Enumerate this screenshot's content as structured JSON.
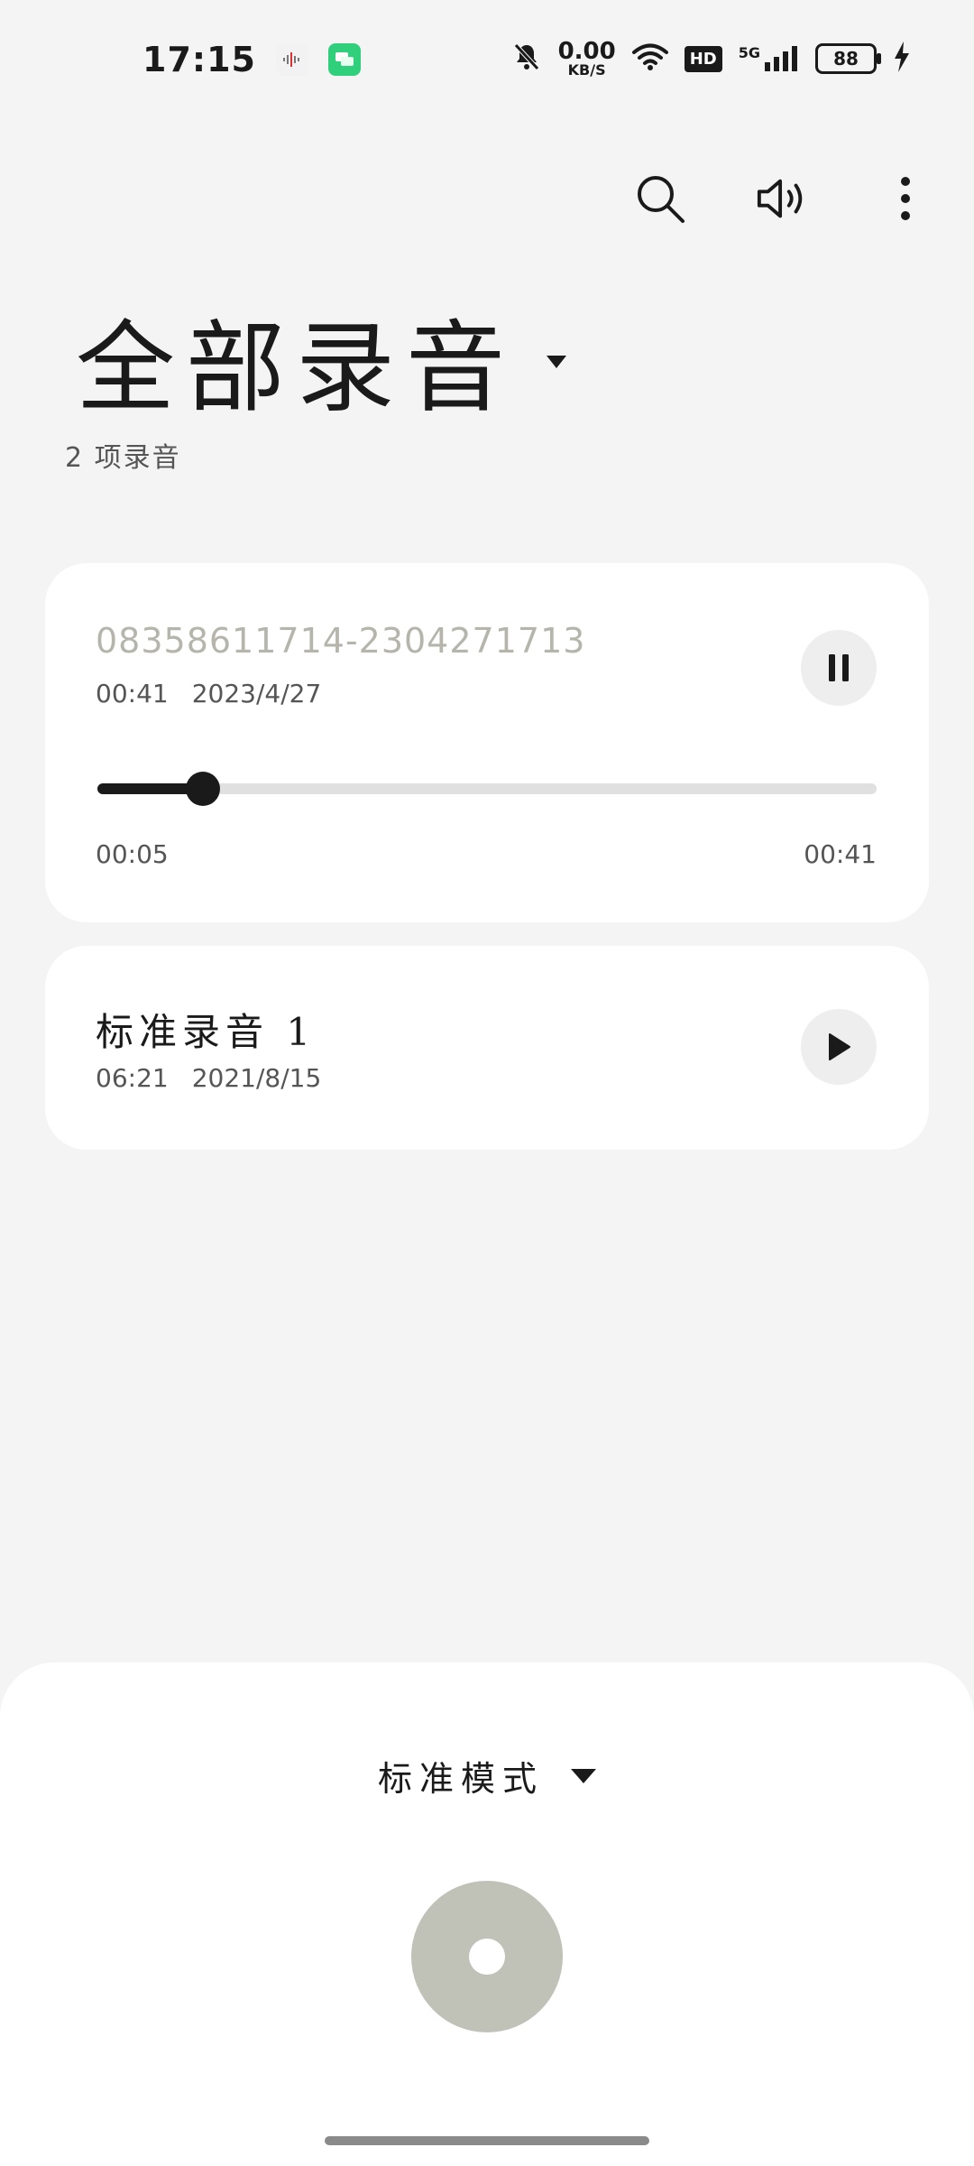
{
  "status_bar": {
    "time": "17:15",
    "net_speed_value": "0.00",
    "net_speed_unit": "KB/S",
    "hd_label": "HD",
    "signal_label": "5G",
    "battery_level": "88"
  },
  "toolbar": {
    "search_icon": "search-icon",
    "speaker_icon": "speaker-icon",
    "more_icon": "more-vert-icon"
  },
  "header": {
    "title": "全部录音",
    "count_label": "2 项录音"
  },
  "recordings": [
    {
      "name": "08358611714-2304271713",
      "duration": "00:41",
      "date": "2023/4/27",
      "state": "playing",
      "progress_fraction": 0.135,
      "elapsed": "00:05",
      "total": "00:41"
    },
    {
      "name": "标准录音 1",
      "duration": "06:21",
      "date": "2021/8/15",
      "state": "paused"
    }
  ],
  "bottom_sheet": {
    "mode_label": "标准模式"
  },
  "colors": {
    "background": "#f4f4f4",
    "card": "#ffffff",
    "accent_dark": "#1a1a1a",
    "record_button": "#c0c2b8",
    "muted_text": "#b5b5ac"
  }
}
